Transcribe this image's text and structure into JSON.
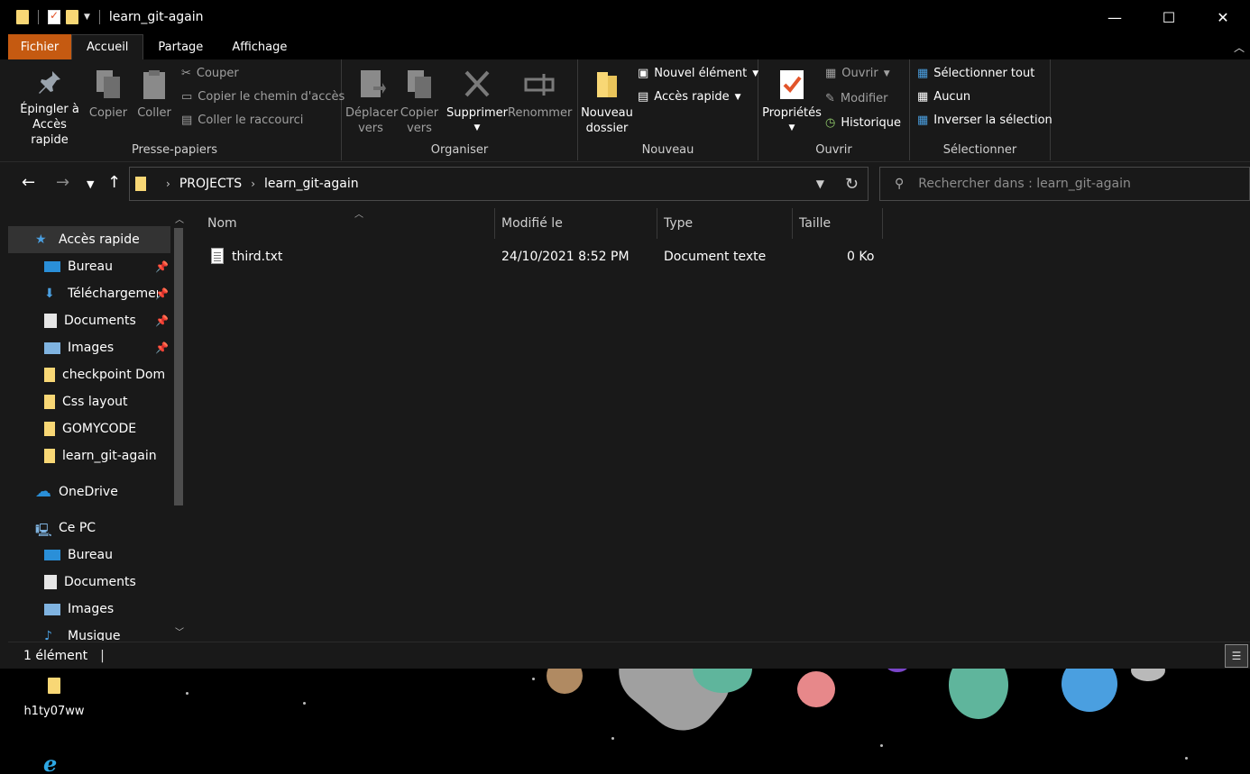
{
  "window": {
    "title": "learn_git-again",
    "controls": {
      "minimize": "—",
      "maximize": "☐",
      "close": "✕"
    }
  },
  "ribbon": {
    "tabs": [
      "Fichier",
      "Accueil",
      "Partage",
      "Affichage"
    ],
    "active_tab": "Accueil",
    "groups": {
      "clipboard": {
        "label": "Presse-papiers",
        "pin_label_1": "Épingler à",
        "pin_label_2": "Accès rapide",
        "copy_label": "Copier",
        "paste_label": "Coller",
        "cut_label": "Couper",
        "copy_path_label": "Copier le chemin d'accès",
        "paste_shortcut_label": "Coller le raccourci"
      },
      "organize": {
        "label": "Organiser",
        "move_label_1": "Déplacer",
        "move_label_2": "vers",
        "copyto_label_1": "Copier",
        "copyto_label_2": "vers",
        "delete_label": "Supprimer",
        "rename_label": "Renommer"
      },
      "new": {
        "label": "Nouveau",
        "new_folder_1": "Nouveau",
        "new_folder_2": "dossier",
        "new_item_label": "Nouvel élément",
        "easy_access_label": "Accès rapide"
      },
      "open": {
        "label": "Ouvrir",
        "properties_label": "Propriétés",
        "open_label": "Ouvrir",
        "edit_label": "Modifier",
        "history_label": "Historique"
      },
      "select": {
        "label": "Sélectionner",
        "select_all_label": "Sélectionner tout",
        "select_none_label": "Aucun",
        "invert_label": "Inverser la sélection"
      }
    }
  },
  "address": {
    "crumbs": [
      "PROJECTS",
      "learn_git-again"
    ],
    "search_placeholder": "Rechercher dans : learn_git-again"
  },
  "navpane": {
    "items": [
      {
        "label": "Accès rapide",
        "icon": "star-icon",
        "pinned": false
      },
      {
        "label": "Bureau",
        "icon": "desktop-icon",
        "pinned": true
      },
      {
        "label": "Téléchargements",
        "icon": "download-icon",
        "pinned": true
      },
      {
        "label": "Documents",
        "icon": "documents-icon",
        "pinned": true
      },
      {
        "label": "Images",
        "icon": "images-icon",
        "pinned": true
      },
      {
        "label": "checkpoint Dom",
        "icon": "folder-icon",
        "pinned": false
      },
      {
        "label": "Css layout",
        "icon": "folder-icon",
        "pinned": false
      },
      {
        "label": "GOMYCODE",
        "icon": "folder-icon",
        "pinned": false
      },
      {
        "label": "learn_git-again",
        "icon": "folder-icon",
        "pinned": false
      },
      {
        "label": "OneDrive",
        "icon": "cloud-icon",
        "pinned": false
      },
      {
        "label": "Ce PC",
        "icon": "computer-icon",
        "pinned": false
      },
      {
        "label": "Bureau",
        "icon": "desktop-icon",
        "pinned": false
      },
      {
        "label": "Documents",
        "icon": "documents-icon",
        "pinned": false
      },
      {
        "label": "Images",
        "icon": "images-icon",
        "pinned": false
      },
      {
        "label": "Musique",
        "icon": "music-icon",
        "pinned": false
      }
    ]
  },
  "filelist": {
    "columns": [
      "Nom",
      "Modifié le",
      "Type",
      "Taille"
    ],
    "rows": [
      {
        "name": "third.txt",
        "modified": "24/10/2021 8:52 PM",
        "type": "Document texte",
        "size": "0 Ko"
      }
    ]
  },
  "status": {
    "count": "1 élément"
  },
  "desktop": {
    "icon_label": "h1ty07ww"
  },
  "colors": {
    "file_tab": "#c55a11",
    "folder": "#f8d775",
    "accent": "#2ea8e5"
  }
}
